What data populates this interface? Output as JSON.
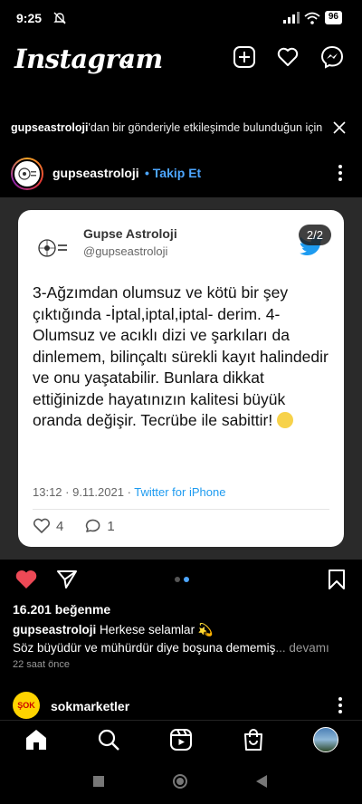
{
  "status_bar": {
    "time": "9:25",
    "battery": "96"
  },
  "header": {
    "logo": "Instagram"
  },
  "suggestion": {
    "username": "gupseastroloji",
    "text": "'dan bir gönderiyle etkileşimde bulunduğun için"
  },
  "post": {
    "username": "gupseastroloji",
    "separator": "•",
    "follow_label": "Takip Et",
    "page_indicator": "2/2",
    "tweet": {
      "name": "Gupse Astroloji",
      "handle": "@gupseastroloji",
      "body": "3-Ağzımdan olumsuz ve kötü bir şey çıktığında -İptal,iptal,iptal- derim. 4-Olumsuz ve acıklı dizi ve şarkıları da dinlemem, bilinçaltı sürekli kayıt halindedir ve onu yaşatabilir. Bunlara dikkat ettiğinizde hayatınızın kalitesi büyük oranda değişir. Tecrübe ile sabittir!",
      "timestamp": "13:12 · 9.11.2021 · ",
      "source": "Twitter for iPhone",
      "likes": "4",
      "replies": "1"
    },
    "likes_text": "16.201 beğenme",
    "caption_user": "gupseastroloji",
    "caption_line1": "Herkese selamlar 💫",
    "caption_line2": "Söz büyüdür ve mühürdür diye boşuna dememiş",
    "caption_more": "... devamı",
    "time_ago": "22 saat önce"
  },
  "next_post": {
    "username": "sokmarketler",
    "avatar_text": "ŞOK"
  },
  "colors": {
    "accent": "#4da6ff",
    "like_red": "#ed4956",
    "twitter_blue": "#1d9bf0"
  }
}
